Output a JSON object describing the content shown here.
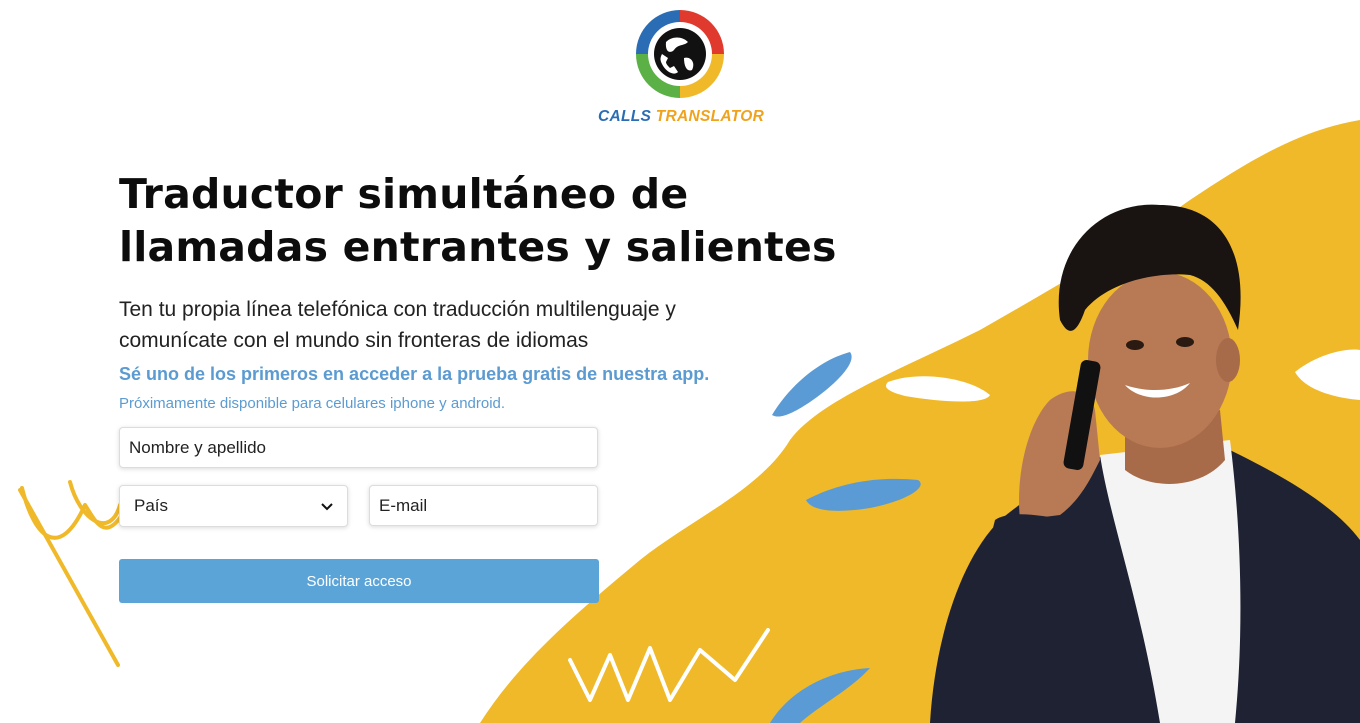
{
  "brand": {
    "name_part1": "CALLS",
    "name_part2": "TRANSLATOR",
    "colors": {
      "blue": "#2a6db5",
      "orange": "#f0a21c",
      "red": "#e03a2f",
      "green": "#5bb146",
      "yellow_bg": "#f0b92a",
      "accent_blue": "#5ba4d7"
    }
  },
  "hero": {
    "headline_line1": "Traductor simultáneo de",
    "headline_line2": "llamadas entrantes y salientes",
    "subtitle_line1": "Ten tu propia línea telefónica con traducción multilenguaje y",
    "subtitle_line2": "comunícate con el mundo sin fronteras de idiomas",
    "cta_text": "Sé uno de los primeros en acceder a la prueba gratis de nuestra app.",
    "availability_text": "Próximamente disponible para celulares iphone y android."
  },
  "form": {
    "name_placeholder": "Nombre y apellido",
    "country_selected": "País",
    "email_placeholder": "E-mail",
    "submit_label": "Solicitar acceso"
  },
  "icons": {
    "dropdown": "chevron-down-icon",
    "logo": "globe-phone-logo-icon",
    "photo": "man-on-phone-photo"
  }
}
